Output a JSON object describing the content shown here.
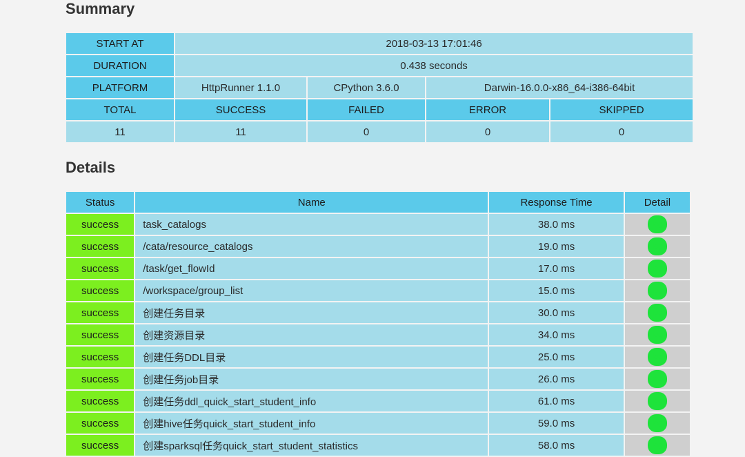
{
  "summary": {
    "title": "Summary",
    "start_at": {
      "label": "START AT",
      "value": "2018-03-13 17:01:46"
    },
    "duration": {
      "label": "DURATION",
      "value": "0.438 seconds"
    },
    "platform": {
      "label": "PLATFORM",
      "httprunner": "HttpRunner 1.1.0",
      "python": "CPython 3.6.0",
      "os": "Darwin-16.0.0-x86_64-i386-64bit"
    },
    "stats": {
      "headers": [
        "TOTAL",
        "SUCCESS",
        "FAILED",
        "ERROR",
        "SKIPPED"
      ],
      "values": [
        "11",
        "11",
        "0",
        "0",
        "0"
      ]
    }
  },
  "details": {
    "title": "Details",
    "columns": [
      "Status",
      "Name",
      "Response Time",
      "Detail"
    ],
    "rows": [
      {
        "status": "success",
        "name": "task_catalogs",
        "time": "38.0 ms",
        "detail": "log"
      },
      {
        "status": "success",
        "name": "/cata/resource_catalogs",
        "time": "19.0 ms",
        "detail": "log"
      },
      {
        "status": "success",
        "name": "/task/get_flowId",
        "time": "17.0 ms",
        "detail": "log"
      },
      {
        "status": "success",
        "name": "/workspace/group_list",
        "time": "15.0 ms",
        "detail": "log"
      },
      {
        "status": "success",
        "name": "创建任务目录",
        "time": "30.0 ms",
        "detail": "log"
      },
      {
        "status": "success",
        "name": "创建资源目录",
        "time": "34.0 ms",
        "detail": "log"
      },
      {
        "status": "success",
        "name": "创建任务DDL目录",
        "time": "25.0 ms",
        "detail": "log"
      },
      {
        "status": "success",
        "name": "创建任务job目录",
        "time": "26.0 ms",
        "detail": "log"
      },
      {
        "status": "success",
        "name": "创建任务ddl_quick_start_student_info",
        "time": "61.0 ms",
        "detail": "log"
      },
      {
        "status": "success",
        "name": "创建hive任务quick_start_student_info",
        "time": "59.0 ms",
        "detail": "log"
      },
      {
        "status": "success",
        "name": "创建sparksql任务quick_start_student_statistics",
        "time": "58.0 ms",
        "detail": "log"
      }
    ]
  }
}
